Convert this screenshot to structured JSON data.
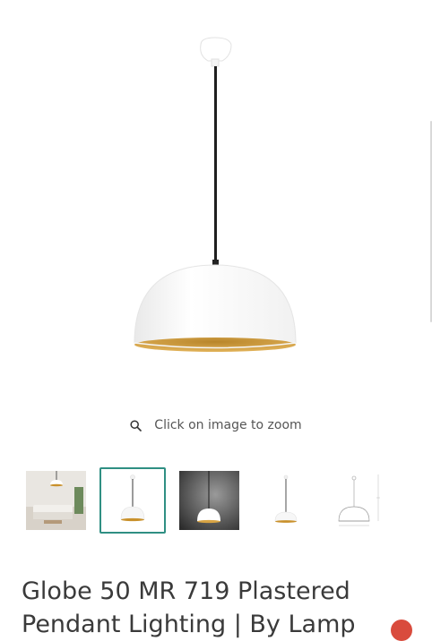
{
  "gallery": {
    "zoom_hint": "Click on image to zoom",
    "thumbnails": [
      {
        "name": "thumb-room-scene",
        "selected": false
      },
      {
        "name": "thumb-white-pendant",
        "selected": true
      },
      {
        "name": "thumb-dark-background",
        "selected": false
      },
      {
        "name": "thumb-small-pendant",
        "selected": false
      },
      {
        "name": "thumb-dimension-drawing",
        "selected": false
      }
    ]
  },
  "product": {
    "title": "Globe 50 MR 719 Plastered Pendant Lighting | By Lamp"
  },
  "colors": {
    "accent": "#2f8f83",
    "shade_inner": "#c9912c",
    "badge": "#d94b3d"
  },
  "icons": {
    "zoom": "search-icon"
  }
}
